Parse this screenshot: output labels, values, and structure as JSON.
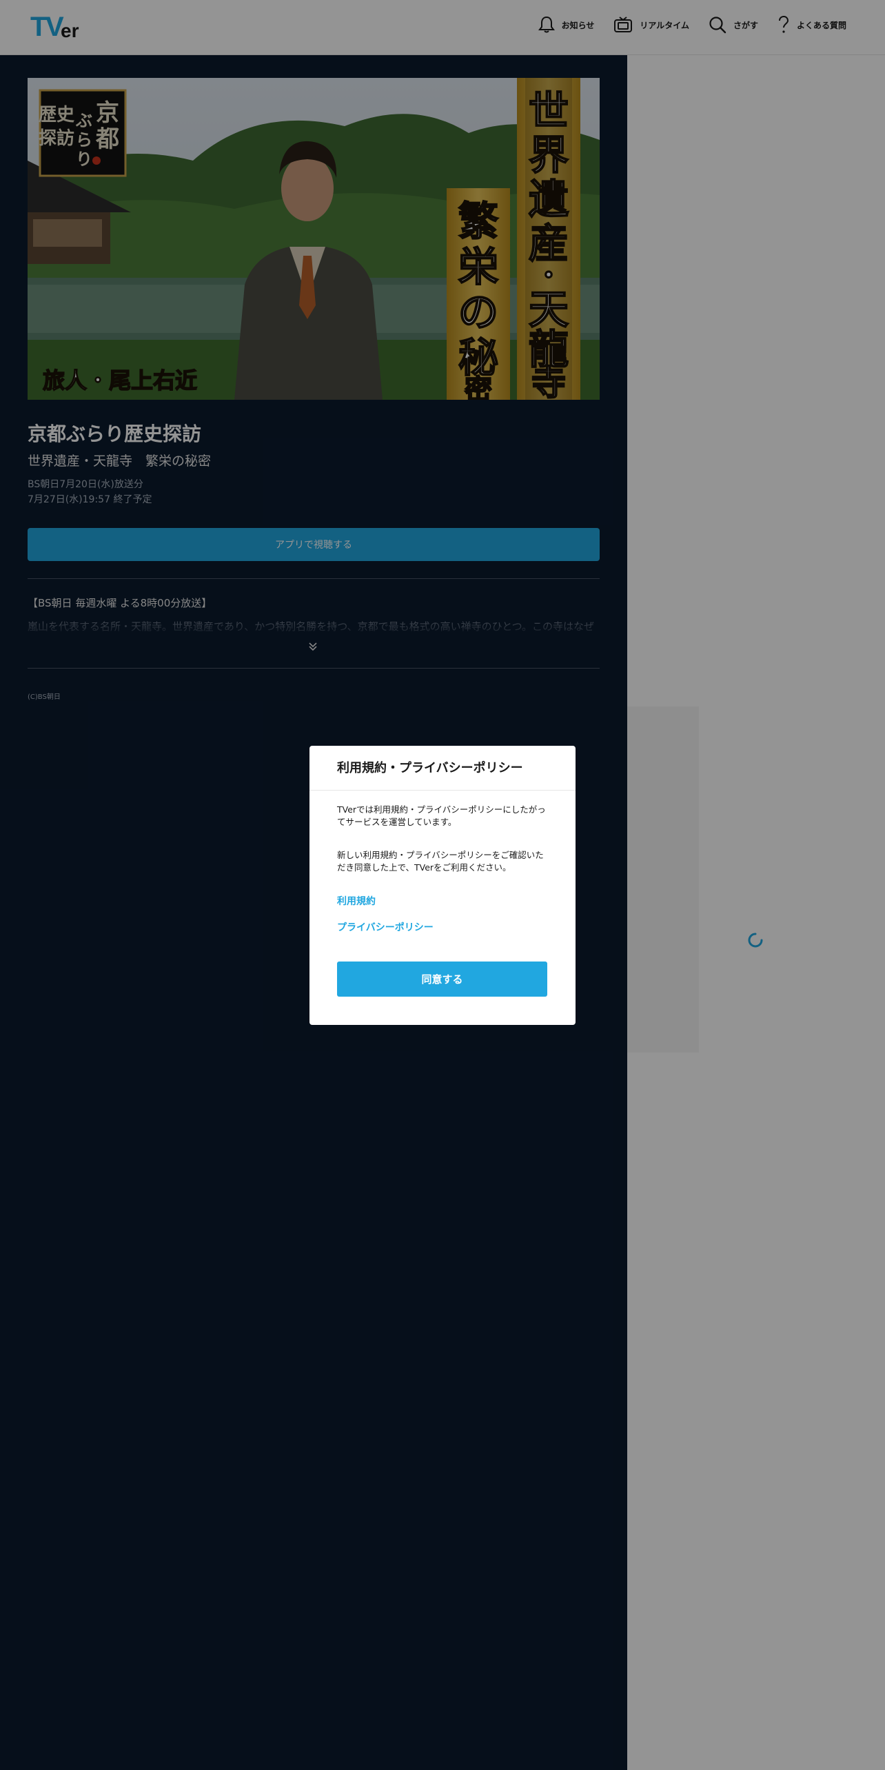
{
  "header": {
    "logo": {
      "t": "T",
      "v": "V",
      "er": "er"
    },
    "nav": [
      {
        "label": "お知らせ",
        "icon": "bell-icon"
      },
      {
        "label": "リアルタイム",
        "icon": "tv-icon"
      },
      {
        "label": "さがす",
        "icon": "search-icon"
      },
      {
        "label": "よくある質問",
        "icon": "question-icon"
      }
    ]
  },
  "episode": {
    "thumbnail_text": {
      "badge": [
        "京",
        "都",
        "ぶ",
        "ら",
        "り",
        "歴史",
        "探訪"
      ],
      "vertical_right": "世界遺産・天龍寺",
      "vertical_left": "繁栄の秘密",
      "bottom_left": "旅人・尾上右近"
    },
    "title": "京都ぶらり歴史探訪",
    "subtitle": "世界遺産・天龍寺　繁栄の秘密",
    "broadcast": "BS朝日7月20日(水)放送分",
    "expiry": "7月27日(水)19:57 終了予定",
    "app_button": "アプリで視聴する",
    "description_line1": "【BS朝日 毎週水曜 よる8時00分放送】",
    "description_line2": "嵐山を代表する名所・天龍寺。世界遺産であり、かつ特別名勝を持つ、京都で最も格式の高い禅寺のひとつ。この寺はなぜ",
    "copyright": "(C)BS朝日"
  },
  "modal": {
    "title": "利用規約・プライバシーポリシー",
    "paragraph1": "TVerでは利用規約・プライバシーポリシーにしたがってサービスを運営しています。",
    "paragraph2": "新しい利用規約・プライバシーポリシーをご確認いただき同意した上で、TVerをご利用ください。",
    "link_terms": "利用規約",
    "link_privacy": "プライバシーポリシー",
    "agree_button": "同意する"
  },
  "colors": {
    "accent": "#21a7e0",
    "dark_bg": "#0b1a2e",
    "overlay": "rgba(0,0,0,0.42)"
  }
}
